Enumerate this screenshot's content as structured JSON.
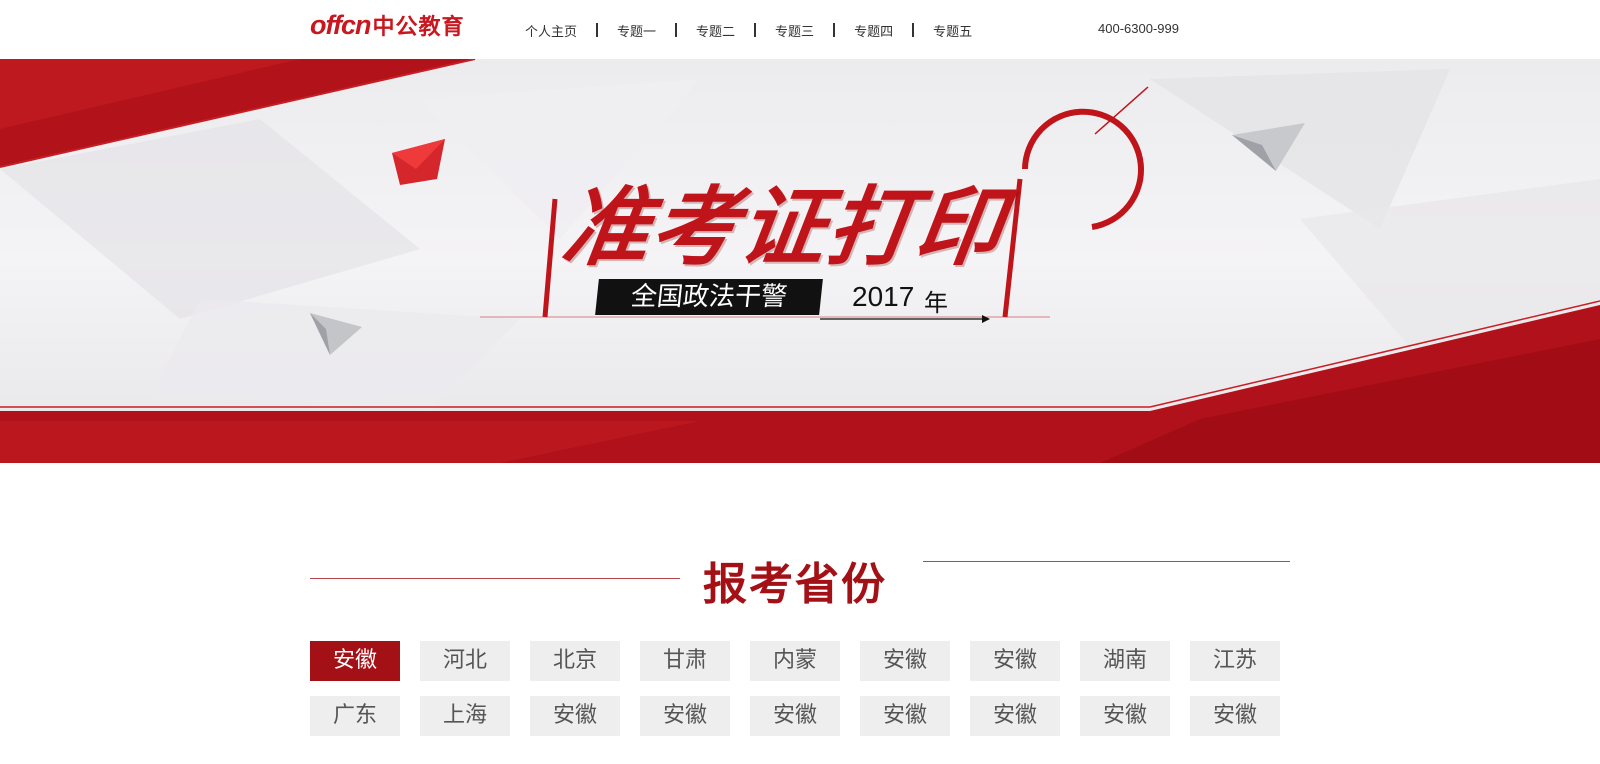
{
  "header": {
    "logo_text": "offcn",
    "logo_cn": "中公教育",
    "nav": [
      {
        "label": "个人主页"
      },
      {
        "label": "专题一"
      },
      {
        "label": "专题二"
      },
      {
        "label": "专题三"
      },
      {
        "label": "专题四"
      },
      {
        "label": "专题五"
      }
    ],
    "phone": "400-6300-999"
  },
  "banner": {
    "title": "准考证打印",
    "tag": "全国政法干警",
    "year": "2017",
    "year_suffix": "年"
  },
  "section": {
    "title": "报考省份"
  },
  "provinces": [
    {
      "label": "安徽",
      "active": true
    },
    {
      "label": "河北",
      "active": false
    },
    {
      "label": "北京",
      "active": false
    },
    {
      "label": "甘肃",
      "active": false
    },
    {
      "label": "内蒙",
      "active": false
    },
    {
      "label": "安徽",
      "active": false
    },
    {
      "label": "安徽",
      "active": false
    },
    {
      "label": "湖南",
      "active": false
    },
    {
      "label": "江苏",
      "active": false
    },
    {
      "label": "广东",
      "active": false
    },
    {
      "label": "上海",
      "active": false
    },
    {
      "label": "安徽",
      "active": false
    },
    {
      "label": "安徽",
      "active": false
    },
    {
      "label": "安徽",
      "active": false
    },
    {
      "label": "安徽",
      "active": false
    },
    {
      "label": "安徽",
      "active": false
    },
    {
      "label": "安徽",
      "active": false
    },
    {
      "label": "安徽",
      "active": false
    }
  ],
  "colors": {
    "brand_red": "#c8171e",
    "dark_red": "#a31016",
    "tile_gray": "#eeeeee"
  }
}
